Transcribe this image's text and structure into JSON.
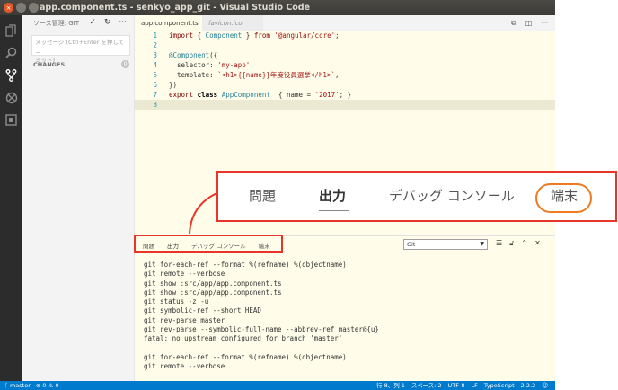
{
  "window": {
    "title": "app.component.ts - senkyo_app_git - Visual Studio Code"
  },
  "activity_bar": {
    "icons": [
      "files-icon",
      "search-icon",
      "git-icon",
      "debug-icon",
      "extensions-icon"
    ]
  },
  "sidebar": {
    "header": "ソース管理: GIT",
    "tools": [
      "✓",
      "↻",
      "···"
    ],
    "commit_placeholder_line1": "メッセージ (Ctrl+Enter を押してコ",
    "commit_placeholder_line2": "ミット)",
    "changes_label": "CHANGES",
    "changes_count": "0"
  },
  "editor": {
    "tabs": [
      {
        "label": "app.component.ts",
        "active": true
      },
      {
        "label": "favicon.ico",
        "active": false
      }
    ],
    "lines": [
      {
        "n": "1",
        "tokens": [
          {
            "t": "import",
            "c": "kw"
          },
          {
            "t": " { ",
            "c": "plain"
          },
          {
            "t": "Component",
            "c": "dec"
          },
          {
            "t": " } ",
            "c": "plain"
          },
          {
            "t": "from",
            "c": "kw"
          },
          {
            "t": " ",
            "c": "plain"
          },
          {
            "t": "'@angular/core'",
            "c": "str"
          },
          {
            "t": ";",
            "c": "plain"
          }
        ]
      },
      {
        "n": "2",
        "tokens": []
      },
      {
        "n": "3",
        "tokens": [
          {
            "t": "@Component",
            "c": "dec"
          },
          {
            "t": "({",
            "c": "plain"
          }
        ]
      },
      {
        "n": "4",
        "tokens": [
          {
            "t": "  selector: ",
            "c": "plain"
          },
          {
            "t": "'my-app'",
            "c": "str"
          },
          {
            "t": ",",
            "c": "plain"
          }
        ]
      },
      {
        "n": "5",
        "tokens": [
          {
            "t": "  template: ",
            "c": "plain"
          },
          {
            "t": "`<h1>{{name}}年度役員選挙</h1>`",
            "c": "str"
          },
          {
            "t": ",",
            "c": "plain"
          }
        ]
      },
      {
        "n": "6",
        "tokens": [
          {
            "t": "})",
            "c": "plain"
          }
        ]
      },
      {
        "n": "7",
        "tokens": [
          {
            "t": "export",
            "c": "kw"
          },
          {
            "t": " ",
            "c": "plain"
          },
          {
            "t": "class",
            "c": "bold"
          },
          {
            "t": " ",
            "c": "plain"
          },
          {
            "t": "AppComponent",
            "c": "dec"
          },
          {
            "t": "  { name = ",
            "c": "plain"
          },
          {
            "t": "'2017'",
            "c": "str"
          },
          {
            "t": "; }",
            "c": "plain"
          }
        ]
      },
      {
        "n": "8",
        "tokens": [],
        "current": true
      }
    ]
  },
  "panel": {
    "tabs": [
      "問題",
      "出力",
      "デバッグ コンソール",
      "端末"
    ],
    "channel": "Git",
    "output": [
      "git for-each-ref --format %(refname) %(objectname)",
      "git remote --verbose",
      "git show :src/app/app.component.ts",
      "git show :src/app/app.component.ts",
      "git status -z -u",
      "git symbolic-ref --short HEAD",
      "git rev-parse master",
      "git rev-parse --symbolic-full-name --abbrev-ref master@{u}",
      "fatal: no upstream configured for branch 'master'",
      "",
      "git for-each-ref --format %(refname) %(objectname)",
      "git remote --verbose"
    ]
  },
  "callout": {
    "tabs": [
      "問題",
      "出力",
      "デバッグ コンソール",
      "端末"
    ],
    "selected": "出力",
    "highlighted": "端末",
    "border_color": "#e8352a",
    "oval_color": "#f07a20"
  },
  "status_bar": {
    "branch": "master",
    "errors": "0",
    "warnings": "0",
    "position": "行 8、列 1",
    "spaces": "スペース: 2",
    "encoding": "UTF-8",
    "eol": "LF",
    "language": "TypeScript",
    "version": "2.2.2",
    "accent": "#007acc"
  }
}
